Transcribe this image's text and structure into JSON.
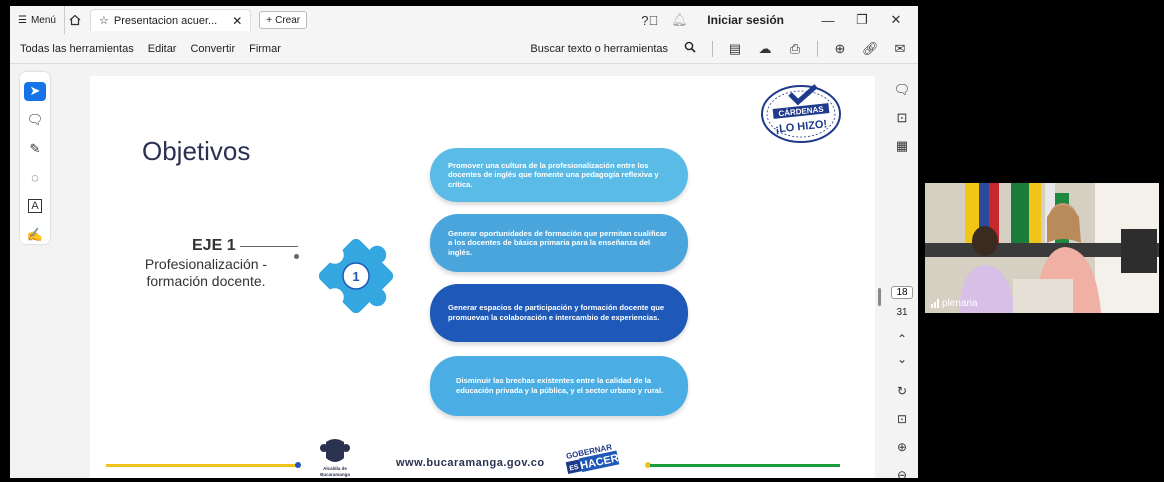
{
  "titlebar": {
    "menu_label": "Menú",
    "tab_title": "Presentacion acuer...",
    "create_label": "Crear",
    "signin_label": "Iniciar sesión"
  },
  "toolbar": {
    "menu_items": [
      "Todas las herramientas",
      "Editar",
      "Convertir",
      "Firmar"
    ],
    "search_label": "Buscar texto o herramientas"
  },
  "pager": {
    "current_page": "18",
    "total_pages": "31"
  },
  "slide": {
    "title": "Objetivos",
    "eje_title": "EJE 1",
    "eje_subtitle": "Profesionalización - formación docente.",
    "puzzle_number": "1",
    "objectives": [
      "Promover una cultura de la profesionalización entre los docentes de inglés que fomente una pedagogía reflexiva y crítica.",
      "Generar oportunidades de formación que permitan cualificar a los docentes de básica primaria para la enseñanza del inglés.",
      "Generar espacios de participación y formación docente que promuevan la colaboración e intercambio de experiencias.",
      "Disminuir las brechas existentes entre la calidad de la educación privada y la pública, y el sector urbano y rural."
    ],
    "seal_text_top": "CÁRDENAS",
    "seal_text_bottom": "¡LO HIZO!",
    "footer_url": "www.bucaramanga.gov.co",
    "crest_caption_1": "Alcaldía de",
    "crest_caption_2": "Bucaramanga",
    "gobernar_top": "GOBERNAR",
    "gobernar_mid": "ES",
    "gobernar_bottom": "HACER"
  },
  "video": {
    "label": "plenaria"
  },
  "colors": {
    "accent": "#1473e6",
    "light_blue": "#5bbbe7",
    "dark_blue": "#1e58b8",
    "yellow": "#f0c21c",
    "green": "#1c9b3c"
  }
}
